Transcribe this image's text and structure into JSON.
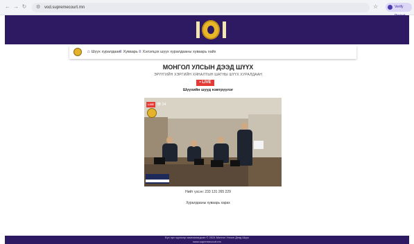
{
  "browser": {
    "url": "vod.supremecourt.mn",
    "profile_label": "Verify Project"
  },
  "menu": {
    "items": [
      {
        "label": "Шүүх хуралдаан",
        "icon": "home-icon"
      },
      {
        "label": "Хуваарь",
        "icon": "list-icon"
      },
      {
        "label": "Хэлэлцэх шүүх хуралдааны хуваарь хайх",
        "icon": "list-icon"
      }
    ]
  },
  "main": {
    "title": "МОНГОЛ УЛСЫН ДЭЭД ШҮҮХ",
    "subtitle": "ЭРҮҮГИЙН ХЭРГИЙН ХЯНАЛТЫН ШАТНЫ ШҮҮХ ХУРАЛДААН",
    "live_badge": "• LIVE",
    "section_heading": "Шүүхийн шууд нэвтрүүлэг",
    "video": {
      "live_label": "LIVE",
      "view_count": "24"
    },
    "viewers_text": "Нийт үзсэн: 233 131 265 229",
    "schedule_link": "Хуралдааны хуваарь харах"
  },
  "footer": {
    "line1": "Бүх эрх хуулиар хамгаалагдсан © 2024 Монгол Улсын Дээд Шүүх",
    "line2": "www.supremecourt.mn"
  },
  "colors": {
    "brand": "#2e1963",
    "gold": "#e7b728",
    "live": "#e53935"
  }
}
